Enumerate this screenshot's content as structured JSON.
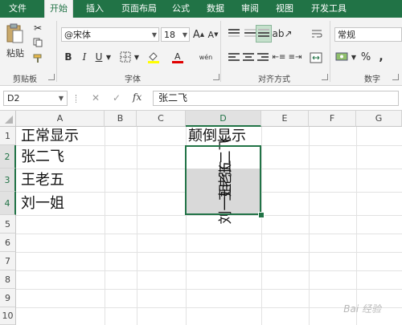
{
  "tabs": [
    "文件",
    "开始",
    "插入",
    "页面布局",
    "公式",
    "数据",
    "审阅",
    "视图",
    "开发工具"
  ],
  "active_tab": "开始",
  "ribbon": {
    "clipboard": {
      "paste_label": "粘贴",
      "group_label": "剪贴板"
    },
    "font": {
      "font_name": "@宋体",
      "font_size": "18",
      "bold": "B",
      "italic": "I",
      "underline": "U",
      "pinyin": "wén",
      "group_label": "字体"
    },
    "alignment": {
      "group_label": "对齐方式"
    },
    "number": {
      "format": "常规",
      "percent": "%",
      "comma": ",",
      "group_label": "数字"
    }
  },
  "formula_bar": {
    "name_box": "D2",
    "fx": "fx",
    "cancel": "✕",
    "enter": "✓",
    "content": "张二飞"
  },
  "sheet": {
    "columns": [
      "A",
      "B",
      "C",
      "D",
      "E",
      "F",
      "G"
    ],
    "selected_column": "D",
    "rows": [
      "1",
      "2",
      "3",
      "4",
      "5",
      "6",
      "7",
      "8",
      "9",
      "10"
    ],
    "selected_rows": [
      "2",
      "3",
      "4"
    ],
    "cells": {
      "A1": "正常显示",
      "A2": "张二飞",
      "A3": "王老五",
      "A4": "刘一姐",
      "D1": "颠倒显示",
      "D2": "张二飞",
      "D3": "王老五",
      "D4": "刘一姐"
    }
  },
  "watermark": "Bai 经验",
  "colors": {
    "accent": "#217346",
    "selection_fill": "#d9d9d9",
    "header": "#f3f3f3"
  }
}
